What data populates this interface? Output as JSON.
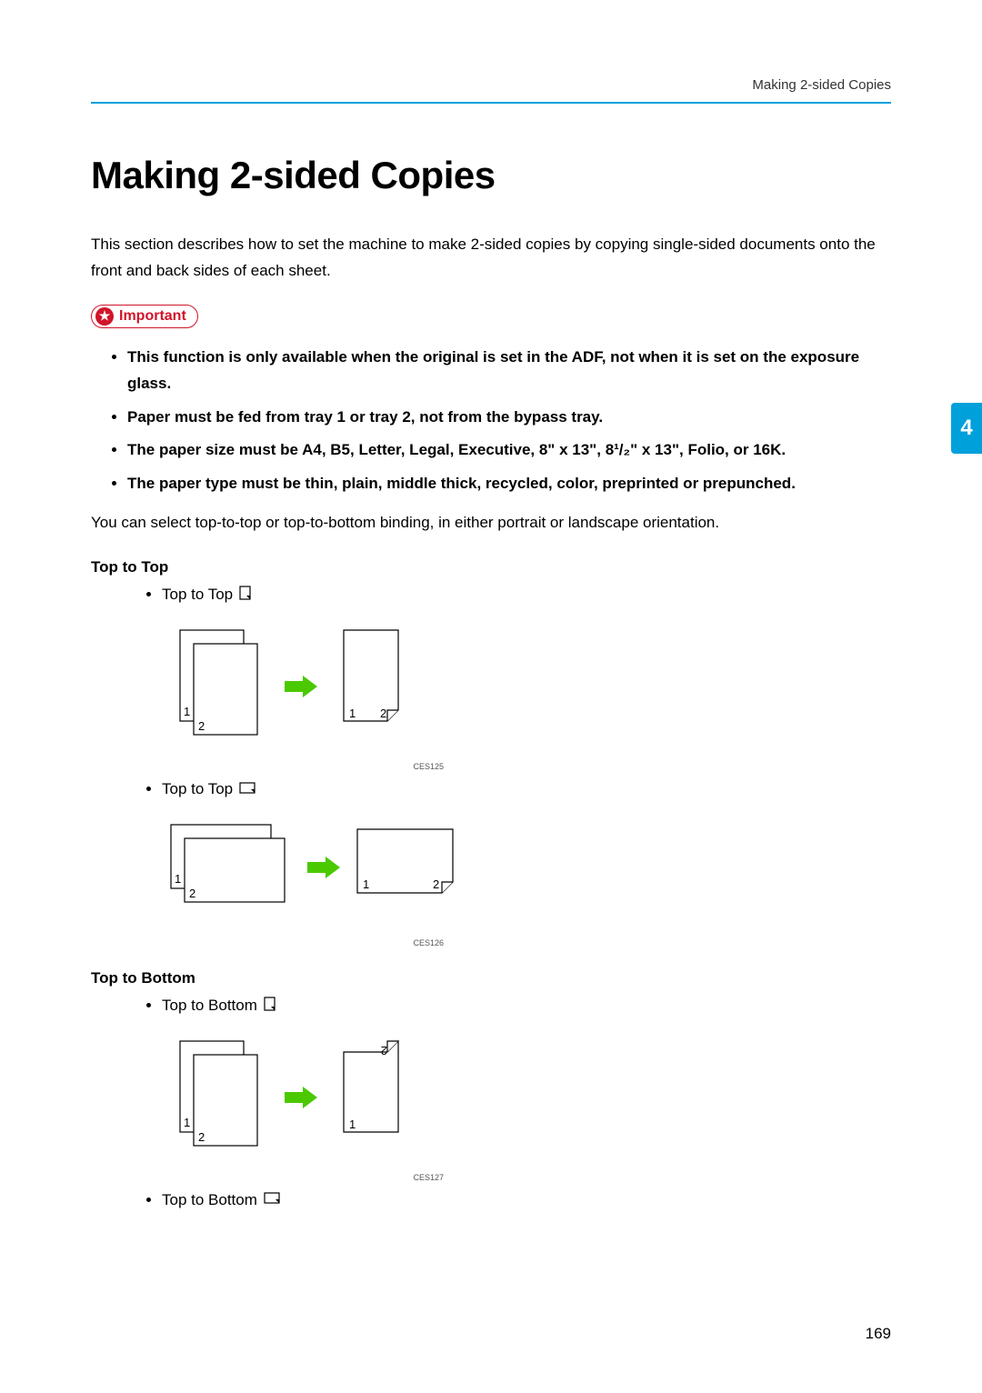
{
  "header": {
    "running": "Making 2-sided Copies"
  },
  "title": "Making 2-sided Copies",
  "intro": "This section describes how to set the machine to make 2-sided copies by copying single-sided documents onto the front and back sides of each sheet.",
  "important": {
    "label": "Important",
    "items": [
      "This function is only available when the original is set in the ADF, not when it is set on the exposure glass.",
      "Paper must be fed from tray 1 or tray 2, not from the bypass tray.",
      "The paper size must be A4, B5, Letter, Legal, Executive, 8\" x 13\", 8¹/₂\" x 13\", Folio, or 16K.",
      "The paper type must be thin, plain, middle thick, recycled, color, preprinted or prepunched."
    ]
  },
  "body_para": "You can select top-to-top or top-to-bottom binding, in either portrait or landscape orientation.",
  "sections": {
    "top_to_top": {
      "heading": "Top to Top",
      "portrait_label": "Top to Top",
      "landscape_label": "Top to Top",
      "ces1": "CES125",
      "ces2": "CES126"
    },
    "top_to_bottom": {
      "heading": "Top to Bottom",
      "portrait_label": "Top to Bottom",
      "landscape_label": "Top to Bottom",
      "ces1": "CES127"
    }
  },
  "chapter_tab": "4",
  "page_number": "169"
}
